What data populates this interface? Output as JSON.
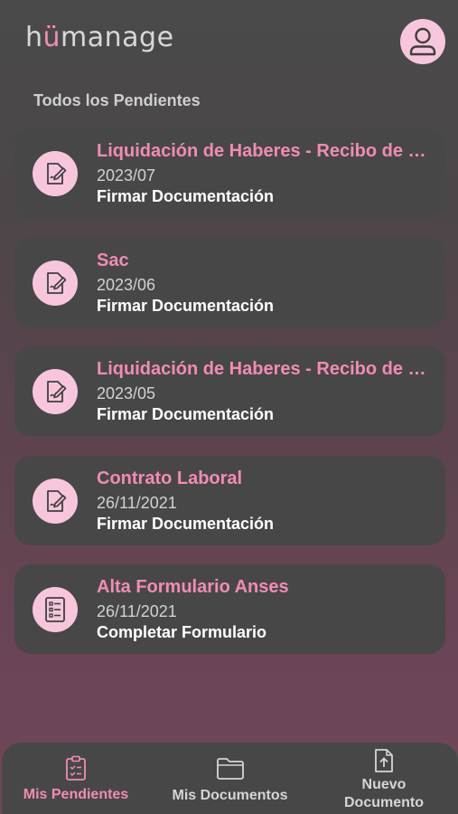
{
  "app": {
    "logo_prefix": "h",
    "logo_accent": "ü",
    "logo_suffix": "manage"
  },
  "header": {
    "avatar_icon": "user-icon"
  },
  "section": {
    "title": "Todos los Pendientes"
  },
  "pendientes": [
    {
      "title": "Liquidación de Haberes - Recibo de Sueldo",
      "date": "2023/07",
      "action": "Firmar Documentación",
      "icon": "sign-document-icon"
    },
    {
      "title": "Sac",
      "date": "2023/06",
      "action": "Firmar Documentación",
      "icon": "sign-document-icon"
    },
    {
      "title": "Liquidación de Haberes - Recibo de Sueldo",
      "date": "2023/05",
      "action": "Firmar Documentación",
      "icon": "sign-document-icon"
    },
    {
      "title": "Contrato Laboral",
      "date": "26/11/2021",
      "action": "Firmar Documentación",
      "icon": "sign-document-icon"
    },
    {
      "title": "Alta Formulario Anses",
      "date": "26/11/2021",
      "action": "Completar Formulario",
      "icon": "form-checklist-icon"
    }
  ],
  "nav": {
    "items": [
      {
        "label": "Mis Pendientes",
        "icon": "clipboard-check-icon",
        "active": true
      },
      {
        "label": "Mis Documentos",
        "icon": "folder-icon",
        "active": false
      },
      {
        "label": "Nuevo Documento",
        "icon": "upload-file-icon",
        "active": false
      }
    ]
  },
  "colors": {
    "accent": "#f28bb5",
    "icon_bg": "#f7c6dc",
    "card_bg": "#474747"
  }
}
